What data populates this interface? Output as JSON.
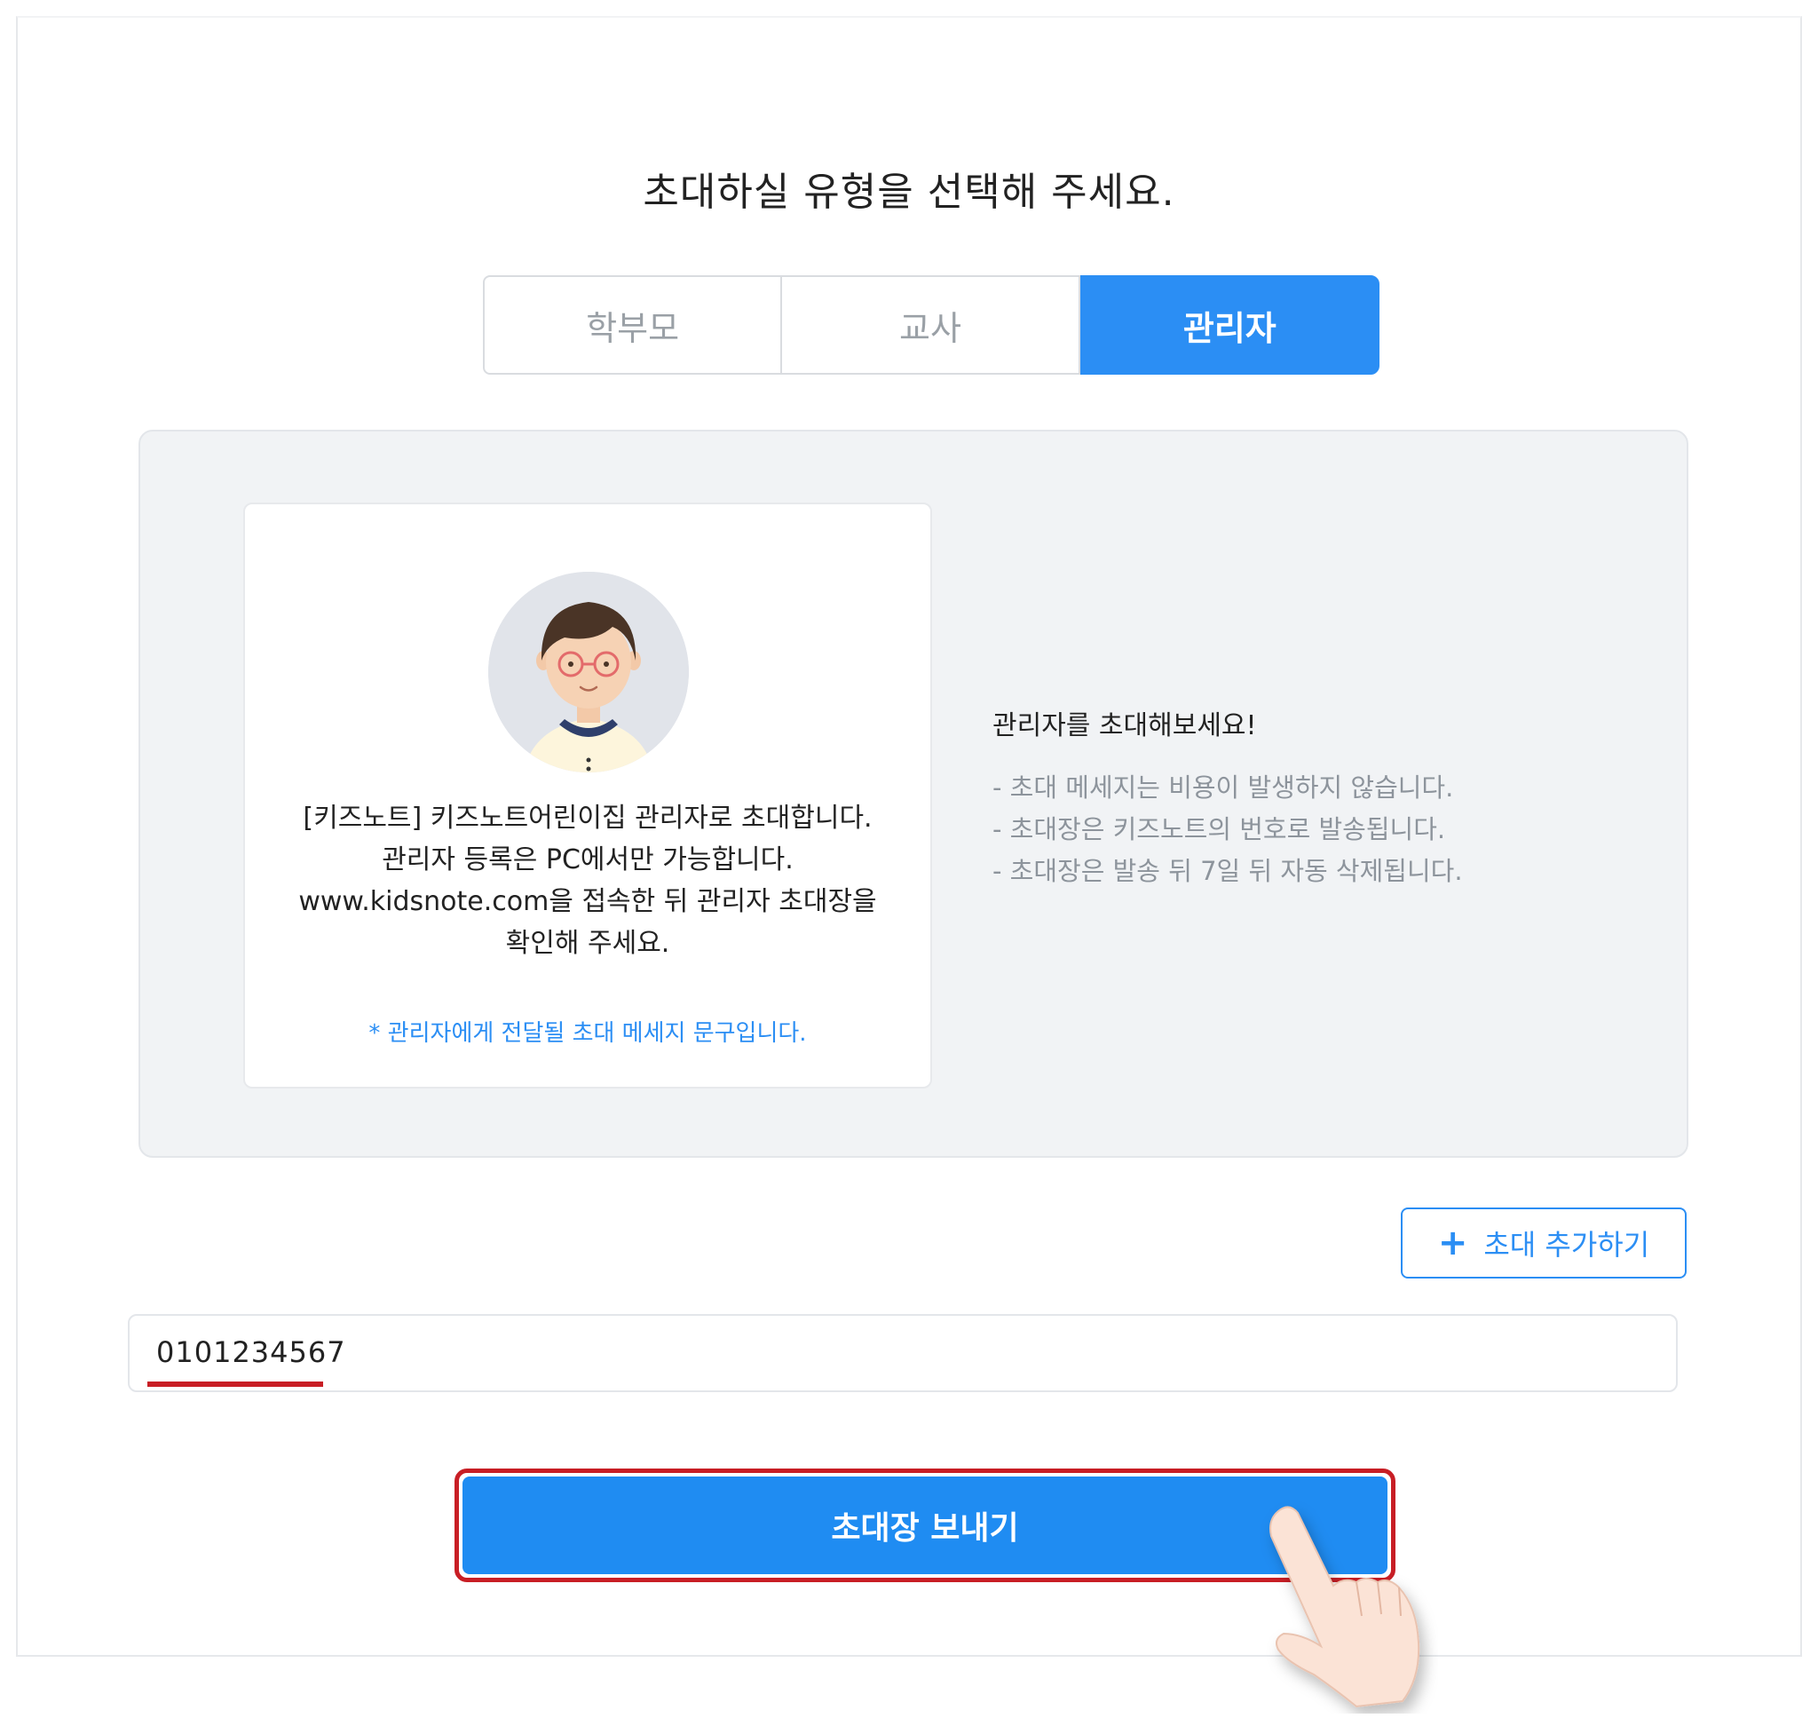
{
  "page": {
    "title": "초대하실 유형을 선택해 주세요."
  },
  "tabs": [
    {
      "label": "학부모",
      "selected": false
    },
    {
      "label": "교사",
      "selected": false
    },
    {
      "label": "관리자",
      "selected": true
    }
  ],
  "preview_card": {
    "avatar_icon": "admin-avatar-icon",
    "message_lines": [
      "[키즈노트] 키즈노트어린이집 관리자로 초대합니다.",
      "관리자 등록은 PC에서만 가능합니다.",
      "www.kidsnote.com을 접속한 뒤 관리자 초대장을",
      "확인해 주세요."
    ],
    "note": "* 관리자에게 전달될 초대 메세지 문구입니다."
  },
  "description": {
    "title": "관리자를 초대해보세요!",
    "items": [
      "- 초대 메세지는 비용이 발생하지 않습니다.",
      "- 초대장은 키즈노트의 번호로 발송됩니다.",
      "- 초대장은 발송 뒤 7일 뒤 자동 삭제됩니다."
    ]
  },
  "add_invite": {
    "icon": "plus-icon",
    "label": "초대 추가하기"
  },
  "phone_input": {
    "value": "0101234567"
  },
  "send_button": {
    "label": "초대장 보내기",
    "highlight_color": "#c81e25"
  },
  "colors": {
    "accent": "#2b8ef4",
    "highlight": "#c81e25",
    "panel_bg": "#f1f3f5"
  }
}
